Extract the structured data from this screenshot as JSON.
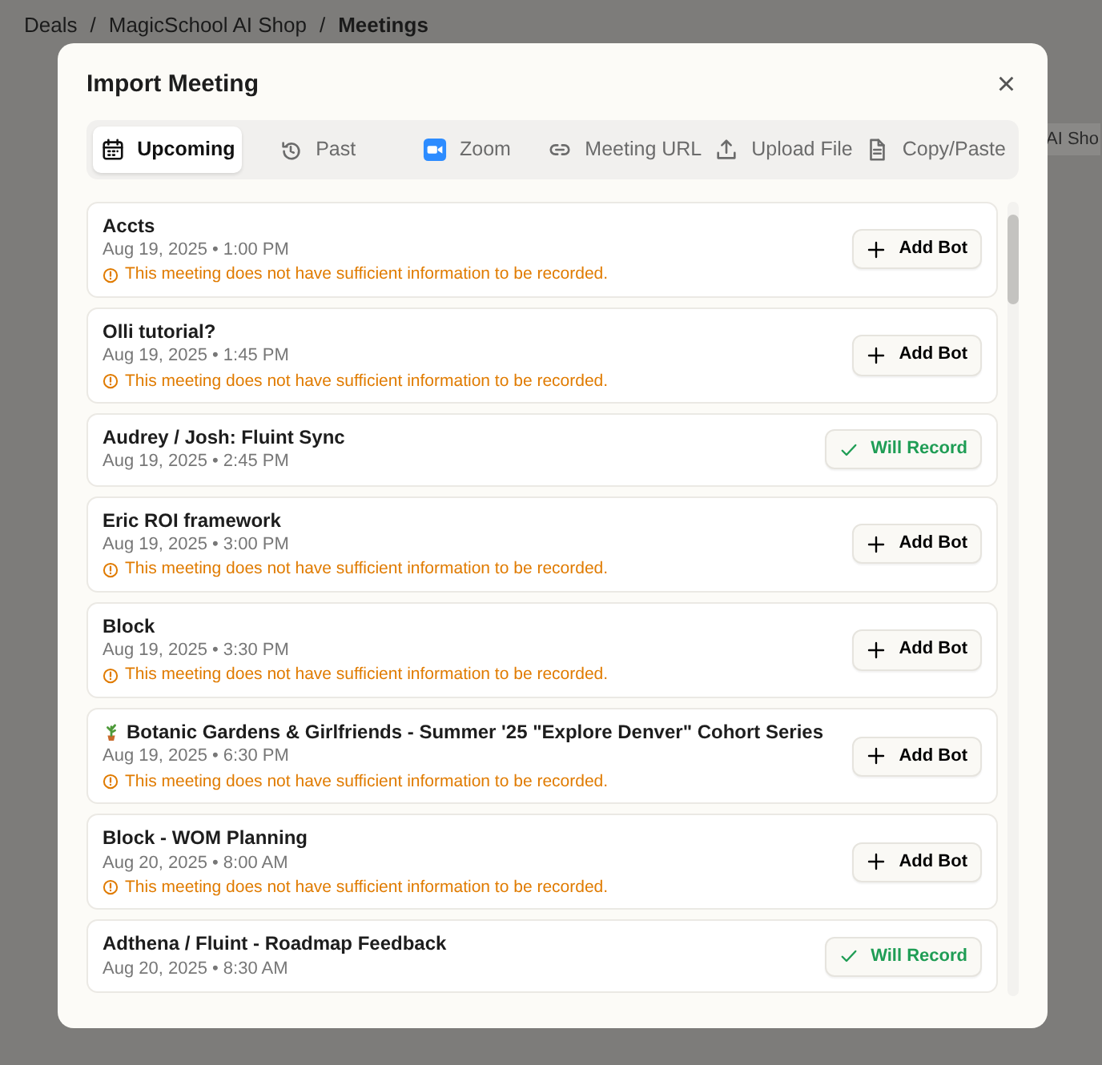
{
  "breadcrumbs": [
    {
      "label": "Deals",
      "current": false
    },
    {
      "label": "MagicSchool AI Shop",
      "current": false
    },
    {
      "label": "Meetings",
      "current": true
    }
  ],
  "breadcrumb_separator": "/",
  "background_tab": "AI Sho",
  "dialog": {
    "title": "Import Meeting",
    "close": "×"
  },
  "tabs": [
    {
      "label": "Upcoming",
      "selected": true
    },
    {
      "label": "Past",
      "selected": false
    },
    {
      "label": "Zoom",
      "selected": false
    },
    {
      "label": "Meeting URL",
      "selected": false
    },
    {
      "label": "Upload File",
      "selected": false
    },
    {
      "label": "Copy/Paste",
      "selected": false
    }
  ],
  "meetings": [
    {
      "title": "Accts",
      "time": "Aug 19, 2025 • 1:00 PM",
      "warning": "This meeting does not have sufficient information to be recorded.",
      "kind": "add_bot",
      "action": "Add Bot"
    },
    {
      "title": "Olli tutorial?",
      "time": "Aug 19, 2025 • 1:45 PM",
      "warning": "This meeting does not have sufficient information to be recorded.",
      "kind": "add_bot",
      "action": "Add Bot"
    },
    {
      "title": "Audrey / Josh: Fluint Sync",
      "time": "Aug 19, 2025 • 2:45 PM",
      "kind": "will_record",
      "action": "Will Record"
    },
    {
      "title": "Eric ROI framework",
      "time": "Aug 19, 2025 • 3:00 PM",
      "warning": "This meeting does not have sufficient information to be recorded.",
      "kind": "add_bot",
      "action": "Add Bot"
    },
    {
      "title": "Block",
      "time": "Aug 19, 2025 • 3:30 PM",
      "warning": "This meeting does not have sufficient information to be recorded.",
      "kind": "add_bot",
      "action": "Add Bot"
    },
    {
      "title": "Botanic Gardens & Girlfriends - Summer '25 \"Explore Denver\" Cohort Series",
      "has_emoji": true,
      "time": "Aug 19, 2025 • 6:30 PM",
      "warning": "This meeting does not have sufficient information to be recorded.",
      "kind": "add_bot",
      "action": "Add Bot"
    },
    {
      "title": "Block - WOM Planning",
      "time": "Aug 20, 2025 • 8:00 AM",
      "warning": "This meeting does not have sufficient information to be recorded.",
      "kind": "add_bot",
      "action": "Add Bot"
    },
    {
      "title": "Adthena / Fluint - Roadmap Feedback",
      "time": "Aug 20, 2025 • 8:30 AM",
      "kind": "will_record",
      "action": "Will Record"
    }
  ]
}
